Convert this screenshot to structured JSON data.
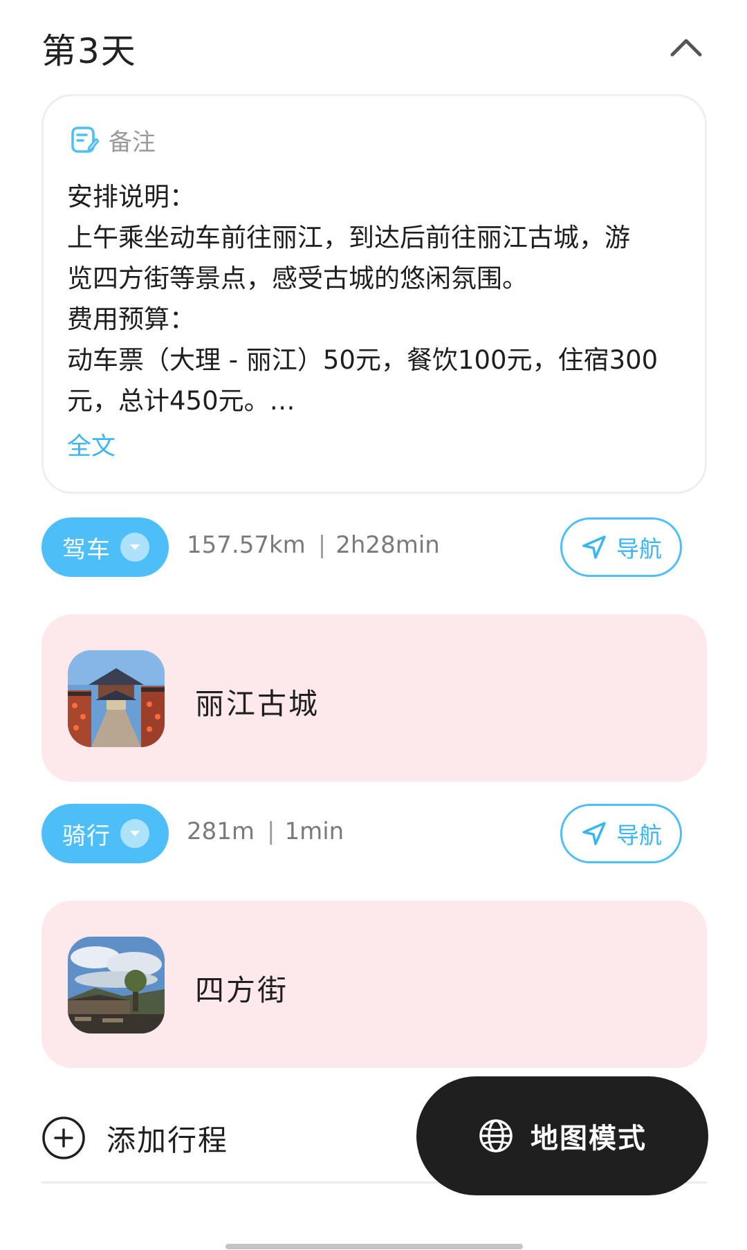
{
  "day": {
    "title": "第3天"
  },
  "note": {
    "label": "备注",
    "lines": [
      "安排说明：",
      "上午乘坐动车前往丽江，到达后前往丽江古城，游",
      "览四方街等景点，感受古城的悠闲氛围。",
      "费用预算：",
      "动车票（大理 - 丽江）50元，餐饮100元，住宿300",
      "元，总计450元。…"
    ],
    "more_label": "全文"
  },
  "segments": [
    {
      "mode": "驾车",
      "distance": "157.57km",
      "separator": "|",
      "duration": "2h28min",
      "nav_label": "导航"
    },
    {
      "mode": "骑行",
      "distance": "281m",
      "separator": "|",
      "duration": "1min",
      "nav_label": "导航"
    }
  ],
  "places": [
    {
      "name": "丽江古城"
    },
    {
      "name": "四方街"
    }
  ],
  "add_itinerary": {
    "label": "添加行程"
  },
  "map_mode": {
    "label": "地图模式"
  },
  "icons": {
    "collapse": "chevron-up-icon",
    "note": "note-edit-icon",
    "dropdown": "chevron-down-icon",
    "navigate": "navigation-arrow-icon",
    "add": "plus-circle-icon",
    "globe": "globe-icon"
  },
  "colors": {
    "accent": "#4dbef7",
    "accent_text": "#3ab6ee",
    "place_card_bg": "#fde8ec",
    "map_button_bg": "#1f1f1f"
  }
}
